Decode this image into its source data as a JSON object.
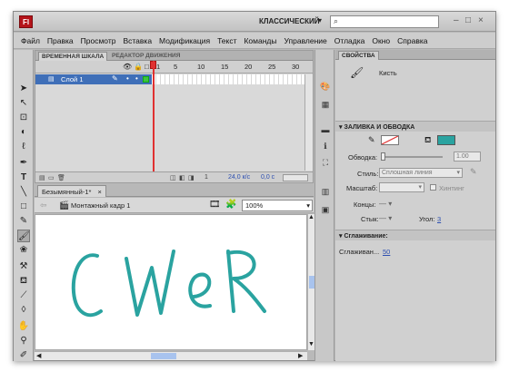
{
  "app": {
    "logo": "Fl",
    "workspace": "КЛАССИЧЕСКИЙ",
    "search_placeholder": "",
    "window_controls": [
      "–",
      "□",
      "×"
    ]
  },
  "menu": [
    "Файл",
    "Правка",
    "Просмотр",
    "Вставка",
    "Модификация",
    "Текст",
    "Команды",
    "Управление",
    "Отладка",
    "Окно",
    "Справка"
  ],
  "timeline": {
    "tabs": [
      "ВРЕМЕННАЯ ШКАЛА",
      "РЕДАКТОР ДВИЖЕНИЯ"
    ],
    "frame_numbers": [
      "1",
      "5",
      "10",
      "15",
      "20",
      "25",
      "30"
    ],
    "layer_name": "Слой 1",
    "footer": {
      "current_frame": "1",
      "fps": "24,0 к/с",
      "time": "0,0 с"
    }
  },
  "document": {
    "tab_label": "Безымянный-1*",
    "scene_label": "Монтажный кадр 1",
    "zoom": "100%",
    "drawn_text": "CWeR"
  },
  "properties": {
    "tab_label": "СВОЙСТВА",
    "tool_name": "Кисть",
    "fill_stroke": {
      "header": "ЗАЛИВКА И ОБВОДКА",
      "fill_color": "#2aa3a0",
      "stroke_label": "Обводка:",
      "stroke_value": "1.00",
      "style_label": "Стиль:",
      "style_value": "Сплошная линия",
      "scale_label": "Масштаб:",
      "hinting_label": "Хинтинг",
      "caps_label": "Концы:",
      "joins_label": "Стык:",
      "angle_label": "Угол:",
      "angle_value": "3"
    },
    "smoothing": {
      "header": "Сглаживание:",
      "label": "Сглаживан...",
      "value": "50"
    }
  },
  "colors": {
    "brush_stroke": "#2aa3a0",
    "layer_selected": "#3f6fb8",
    "playhead": "#e03131"
  }
}
